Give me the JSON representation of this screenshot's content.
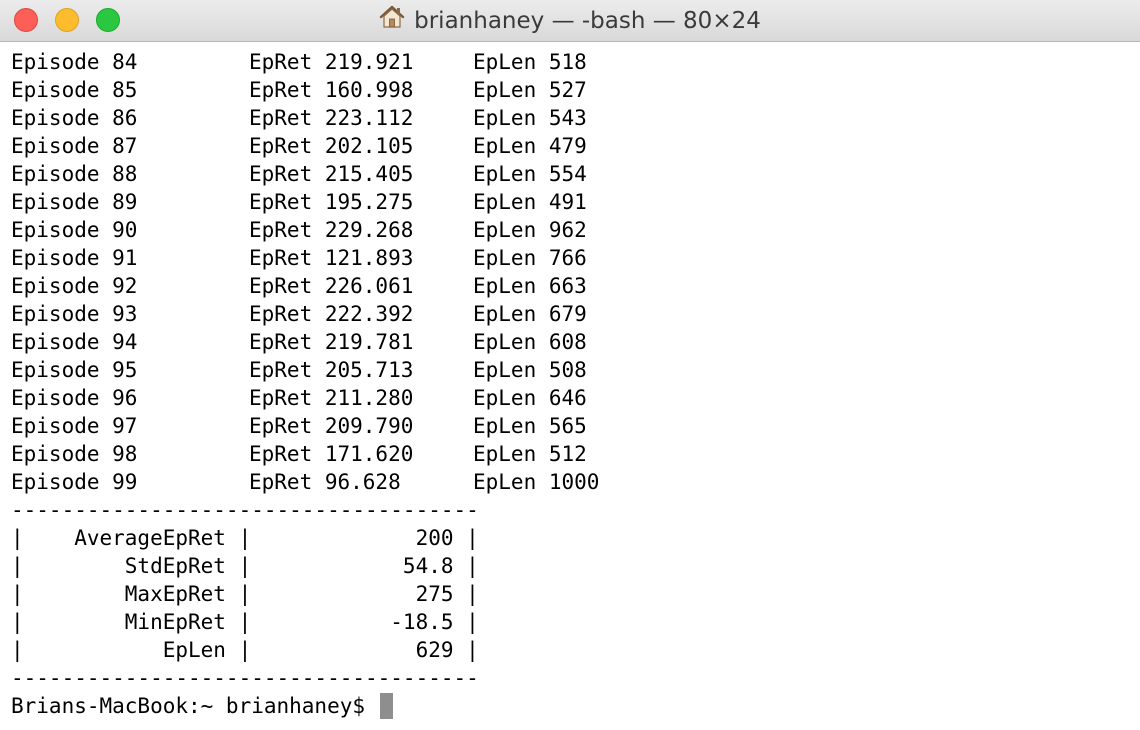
{
  "window": {
    "title": "brianhaney — -bash — 80×24",
    "title_icon": "home-folder-icon",
    "traffic_lights": {
      "close": "#fc5f57",
      "minimize": "#fdbc2e",
      "zoom": "#29c840"
    }
  },
  "terminal": {
    "episodes": [
      {
        "episode": "Episode 84",
        "ret": "EpRet 219.921",
        "len": "EpLen 518"
      },
      {
        "episode": "Episode 85",
        "ret": "EpRet 160.998",
        "len": "EpLen 527"
      },
      {
        "episode": "Episode 86",
        "ret": "EpRet 223.112",
        "len": "EpLen 543"
      },
      {
        "episode": "Episode 87",
        "ret": "EpRet 202.105",
        "len": "EpLen 479"
      },
      {
        "episode": "Episode 88",
        "ret": "EpRet 215.405",
        "len": "EpLen 554"
      },
      {
        "episode": "Episode 89",
        "ret": "EpRet 195.275",
        "len": "EpLen 491"
      },
      {
        "episode": "Episode 90",
        "ret": "EpRet 229.268",
        "len": "EpLen 962"
      },
      {
        "episode": "Episode 91",
        "ret": "EpRet 121.893",
        "len": "EpLen 766"
      },
      {
        "episode": "Episode 92",
        "ret": "EpRet 226.061",
        "len": "EpLen 663"
      },
      {
        "episode": "Episode 93",
        "ret": "EpRet 222.392",
        "len": "EpLen 679"
      },
      {
        "episode": "Episode 94",
        "ret": "EpRet 219.781",
        "len": "EpLen 608"
      },
      {
        "episode": "Episode 95",
        "ret": "EpRet 205.713",
        "len": "EpLen 508"
      },
      {
        "episode": "Episode 96",
        "ret": "EpRet 211.280",
        "len": "EpLen 646"
      },
      {
        "episode": "Episode 97",
        "ret": "EpRet 209.790",
        "len": "EpLen 565"
      },
      {
        "episode": "Episode 98",
        "ret": "EpRet 171.620",
        "len": "EpLen 512"
      },
      {
        "episode": "Episode 99",
        "ret": "EpRet 96.628",
        "len": "EpLen 1000"
      }
    ],
    "summary_table": {
      "border": "-------------------------------------",
      "rows": [
        "|    AverageEpRet |             200 |",
        "|        StdEpRet |            54.8 |",
        "|        MaxEpRet |             275 |",
        "|        MinEpRet |           -18.5 |",
        "|           EpLen |             629 |"
      ]
    },
    "prompt": "Brians-MacBook:~ brianhaney$ "
  }
}
